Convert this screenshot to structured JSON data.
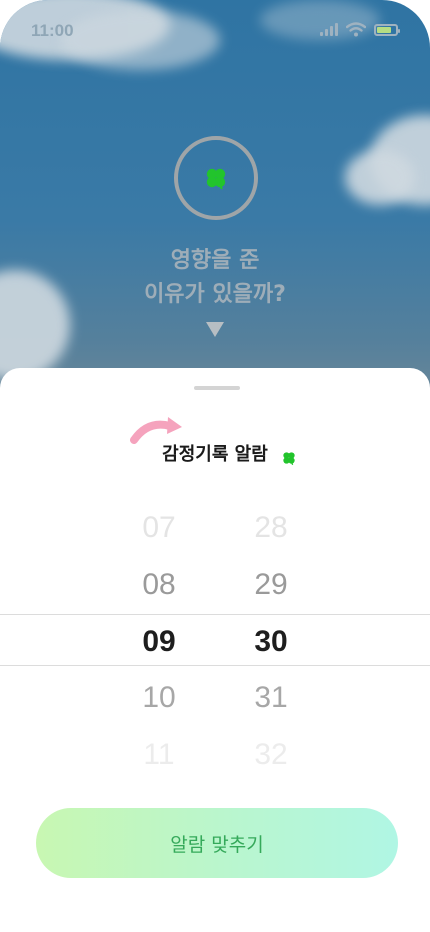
{
  "status_bar": {
    "time": "11:00"
  },
  "prompt": {
    "line1": "영향을 준",
    "line2": "이유가 있을까?"
  },
  "sheet": {
    "title": "감정기록 알람"
  },
  "picker": {
    "hours": [
      "07",
      "08",
      "09",
      "10",
      "11"
    ],
    "minutes": [
      "28",
      "29",
      "30",
      "31",
      "32"
    ],
    "selected_hour": "09",
    "selected_minute": "30"
  },
  "cta": {
    "label": "알람 맞추기"
  },
  "colors": {
    "accent_green": "#35a95a",
    "clover_green": "#22c42c",
    "arrow_pink": "#f5a3bd"
  },
  "icons": {
    "clover": "clover-icon",
    "arrow": "curved-arrow-icon",
    "wifi": "wifi-icon",
    "signal": "signal-icon",
    "battery": "battery-icon"
  }
}
